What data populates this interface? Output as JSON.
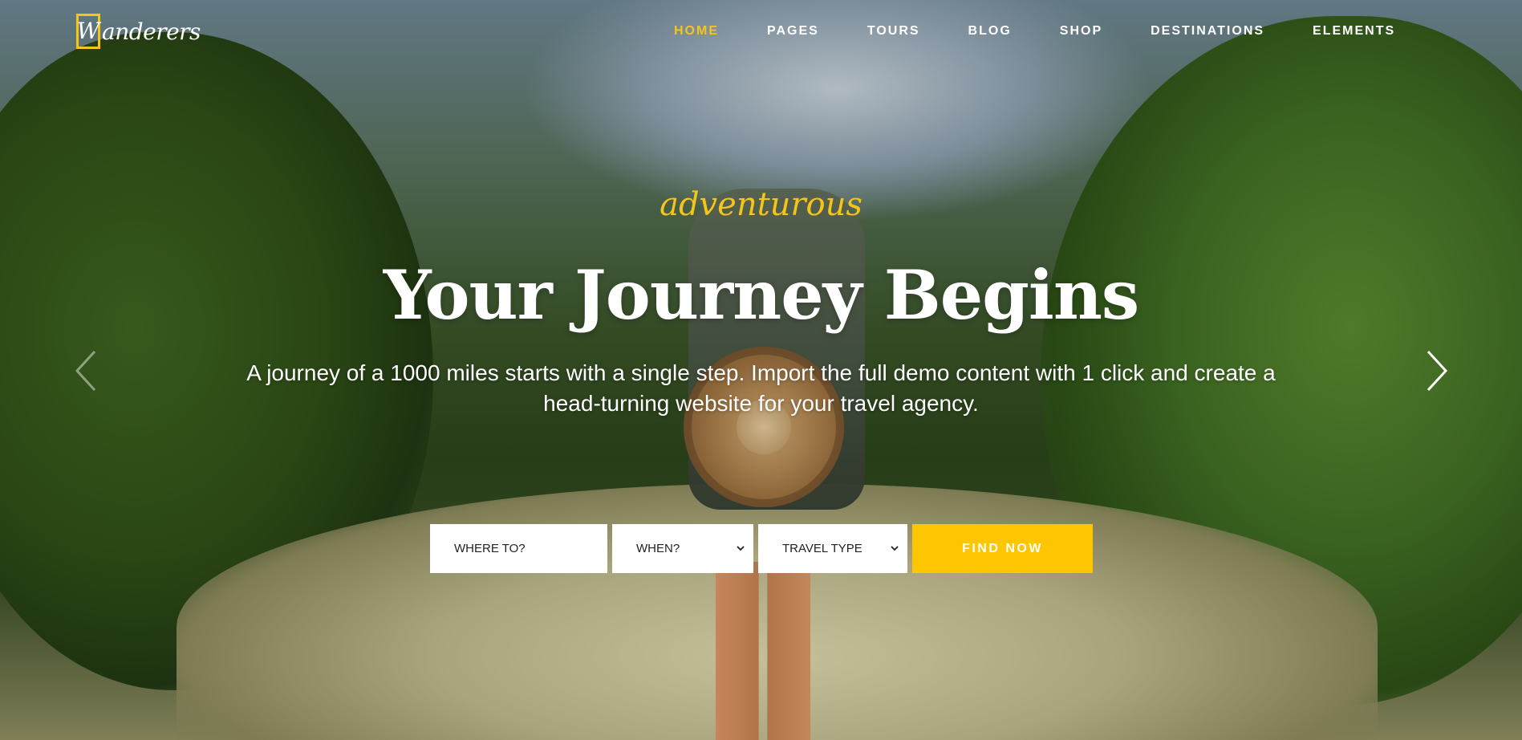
{
  "brand": {
    "logo_initial": "W",
    "logo_rest": "anderers",
    "accent_color": "#f5c51a",
    "button_color": "#fec601"
  },
  "nav": {
    "items": [
      {
        "label": "HOME",
        "active": true
      },
      {
        "label": "PAGES",
        "active": false
      },
      {
        "label": "TOURS",
        "active": false
      },
      {
        "label": "BLOG",
        "active": false
      },
      {
        "label": "SHOP",
        "active": false
      },
      {
        "label": "DESTINATIONS",
        "active": false
      },
      {
        "label": "ELEMENTS",
        "active": false
      }
    ]
  },
  "hero": {
    "script_tag": "adventurous",
    "headline": "Your Journey Begins",
    "subtext": "A journey of a 1000 miles starts with a single step. Import the full demo content with 1 click and create a head-turning website for your travel agency.",
    "prev_icon": "chevron-left-icon",
    "next_icon": "chevron-right-icon"
  },
  "search": {
    "where_placeholder": "WHERE TO?",
    "when_label": "WHEN?",
    "type_label": "TRAVEL TYPE",
    "dropdown_icon": "chevron-down-icon",
    "button_label": "FIND NOW"
  }
}
